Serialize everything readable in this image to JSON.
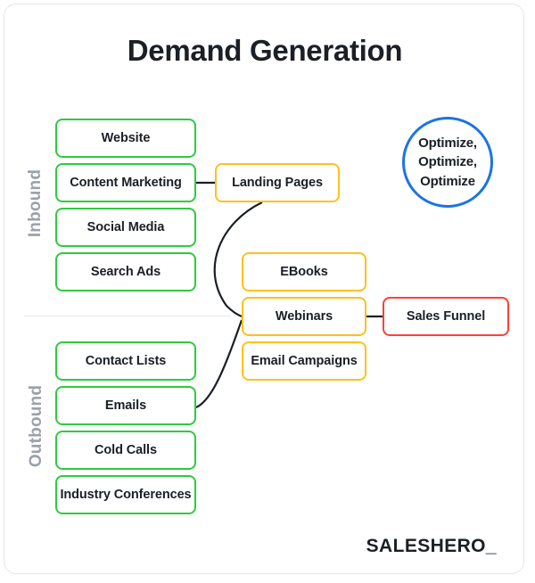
{
  "page": {
    "title": "Demand Generation",
    "brand": "SALESHERO_",
    "background": "#ffffff",
    "card_border": "#e3e6ea"
  },
  "colors": {
    "green": "#2ecb3f",
    "amber": "#ffc01e",
    "red": "#ff4038",
    "blue": "#1a73e8",
    "text": "#1b1f26",
    "muted": "#9aa1ab",
    "connector": "#1b1f26"
  },
  "sections": [
    {
      "key": "inbound",
      "label": "Inbound"
    },
    {
      "key": "outbound",
      "label": "Outbound"
    }
  ],
  "nodes": {
    "inbound_channels": [
      {
        "label": "Website",
        "color": "green"
      },
      {
        "label": "Content Marketing",
        "color": "green"
      },
      {
        "label": "Social Media",
        "color": "green"
      },
      {
        "label": "Search Ads",
        "color": "green"
      }
    ],
    "outbound_channels": [
      {
        "label": "Contact Lists",
        "color": "green"
      },
      {
        "label": "Emails",
        "color": "green"
      },
      {
        "label": "Cold Calls",
        "color": "green"
      },
      {
        "label": "Industry Conferences",
        "color": "green"
      }
    ],
    "assets": [
      {
        "label": "Landing Pages",
        "color": "amber"
      },
      {
        "label": "EBooks",
        "color": "amber"
      },
      {
        "label": "Webinars",
        "color": "amber"
      },
      {
        "label": "Email Campaigns",
        "color": "amber"
      }
    ],
    "outcome": {
      "label": "Sales Funnel",
      "color": "red"
    }
  },
  "optimize_badge": {
    "line1": "Optimize,",
    "line2": "Optimize,",
    "line3": "Optimize"
  },
  "connections": [
    {
      "from": "Content Marketing",
      "to": "Landing Pages",
      "style": "straight"
    },
    {
      "from": "Landing Pages",
      "to": "Webinars",
      "style": "curve"
    },
    {
      "from": "Emails",
      "to": "Webinars",
      "style": "curve"
    },
    {
      "from": "Webinars",
      "to": "Sales Funnel",
      "style": "straight"
    }
  ]
}
